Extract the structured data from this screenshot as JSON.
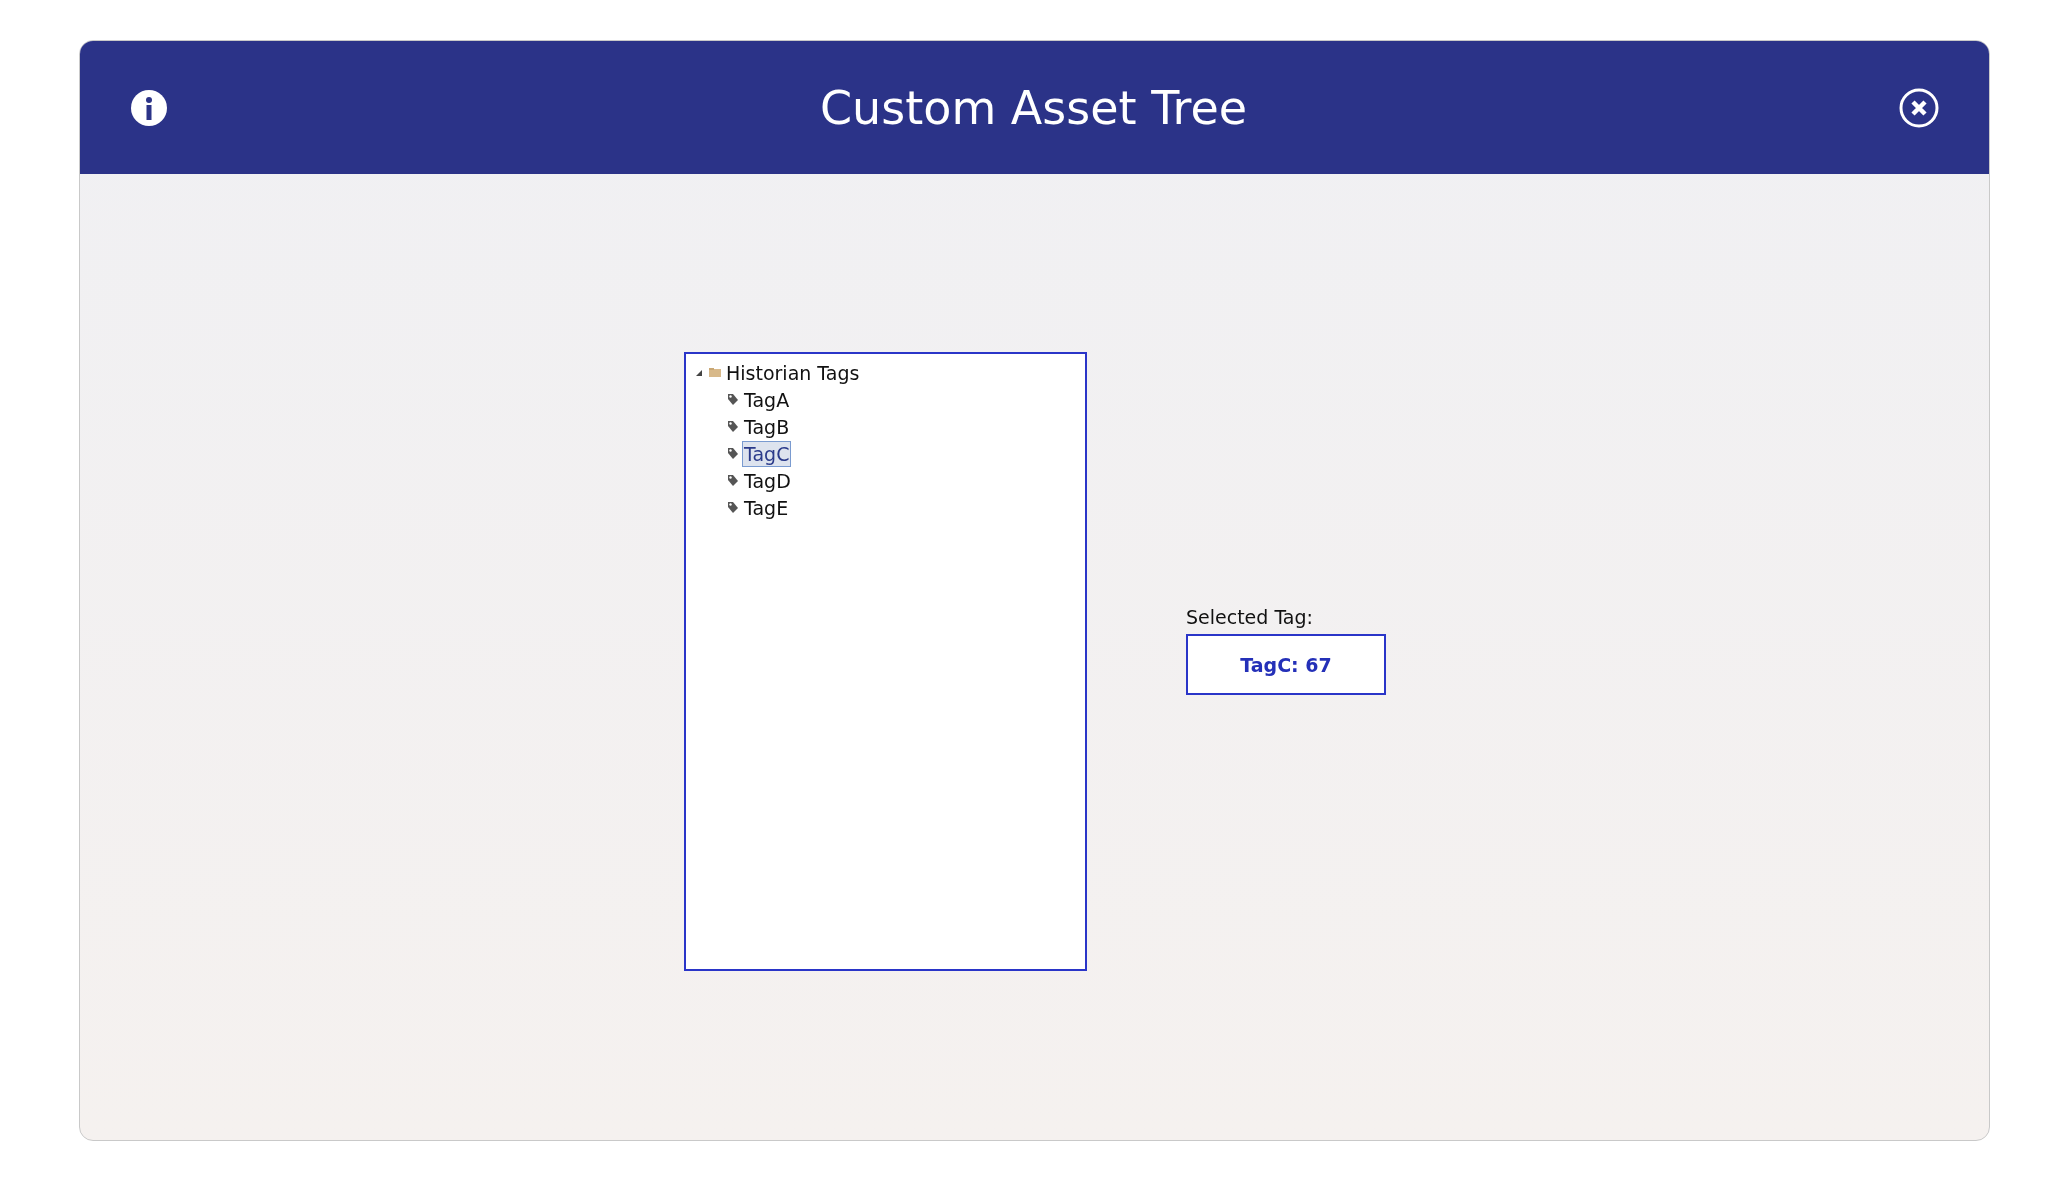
{
  "header": {
    "title": "Custom Asset Tree"
  },
  "tree": {
    "items": [
      {
        "label": "Historian Tags",
        "kind": "folder",
        "expanded": true,
        "selected": false,
        "children": [
          {
            "label": "TagA",
            "kind": "tag",
            "selected": false
          },
          {
            "label": "TagB",
            "kind": "tag",
            "selected": false
          },
          {
            "label": "TagC",
            "kind": "tag",
            "selected": true
          },
          {
            "label": "TagD",
            "kind": "tag",
            "selected": false
          },
          {
            "label": "TagE",
            "kind": "tag",
            "selected": false
          }
        ]
      }
    ]
  },
  "selected_tag": {
    "label": "Selected Tag:",
    "value": "TagC: 67"
  }
}
